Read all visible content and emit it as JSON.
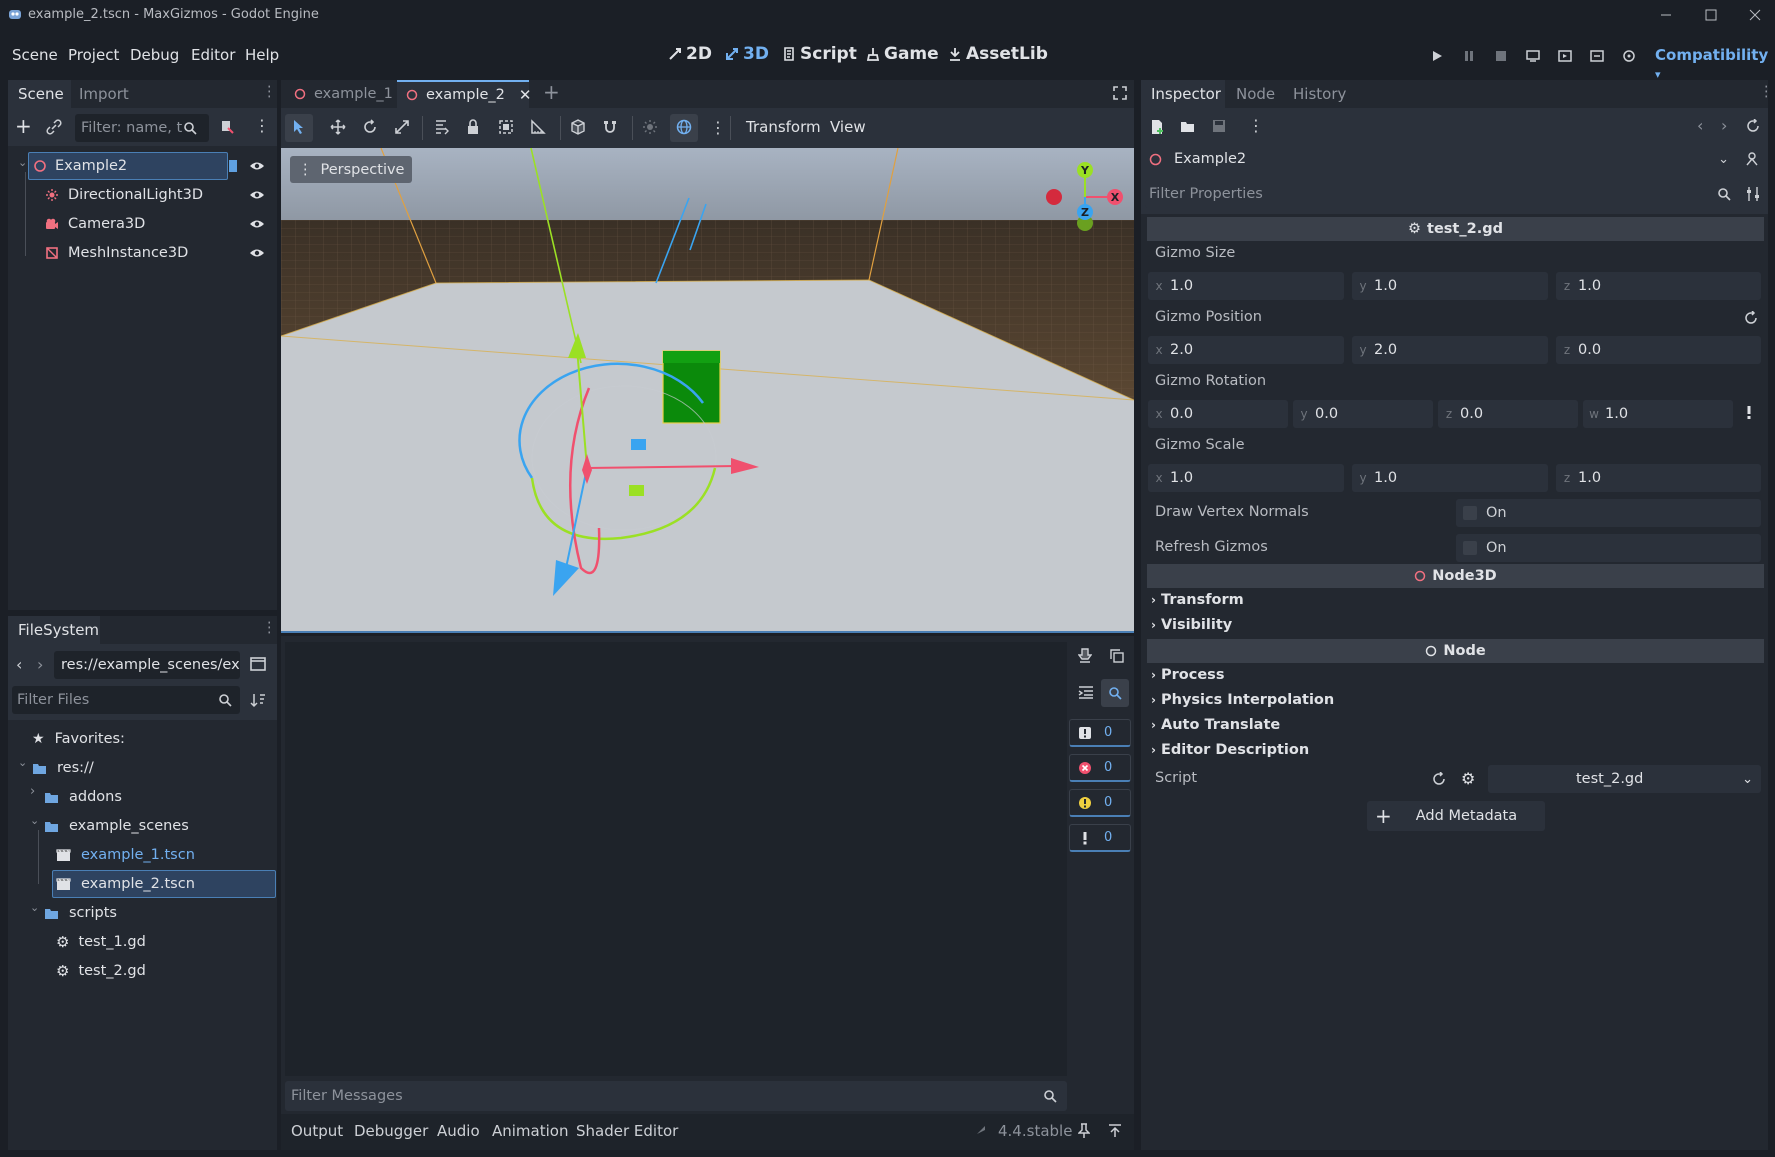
{
  "window": {
    "title": "example_2.tscn - MaxGizmos - Godot Engine"
  },
  "menu": [
    "Scene",
    "Project",
    "Debug",
    "Editor",
    "Help"
  ],
  "main_tabs": [
    {
      "label": "2D",
      "active": false
    },
    {
      "label": "3D",
      "active": true
    },
    {
      "label": "Script",
      "active": false
    },
    {
      "label": "Game",
      "active": false
    },
    {
      "label": "AssetLib",
      "active": false
    }
  ],
  "renderer": "Compatibility",
  "scene_dock": {
    "tabs": [
      "Scene",
      "Import"
    ],
    "filter_placeholder": "Filter: name, t:t",
    "tree": [
      {
        "label": "Example2",
        "icon": "node3d-icon",
        "selected": true
      },
      {
        "label": "DirectionalLight3D",
        "icon": "light-icon"
      },
      {
        "label": "Camera3D",
        "icon": "camera-icon"
      },
      {
        "label": "MeshInstance3D",
        "icon": "mesh-icon"
      }
    ]
  },
  "filesystem": {
    "tab": "FileSystem",
    "path": "res://example_scenes/exa",
    "filter_placeholder": "Filter Files",
    "items": [
      {
        "label": "Favorites:",
        "icon": "star-icon"
      },
      {
        "label": "res://",
        "icon": "folder-icon"
      },
      {
        "label": "addons",
        "icon": "folder-icon"
      },
      {
        "label": "example_scenes",
        "icon": "folder-icon"
      },
      {
        "label": "example_1.tscn",
        "icon": "scene-icon"
      },
      {
        "label": "example_2.tscn",
        "icon": "scene-icon",
        "selected": true
      },
      {
        "label": "scripts",
        "icon": "folder-icon"
      },
      {
        "label": "test_1.gd",
        "icon": "gear-icon"
      },
      {
        "label": "test_2.gd",
        "icon": "gear-icon"
      }
    ]
  },
  "editor_tabs": [
    {
      "label": "example_1",
      "active": false
    },
    {
      "label": "example_2",
      "active": true
    }
  ],
  "viewport_toolbar": {
    "transform": "Transform",
    "view": "View"
  },
  "viewport": {
    "perspective": "Perspective",
    "gizmo_axes": [
      "Y",
      "X",
      "Z"
    ]
  },
  "output": {
    "counters": [
      0,
      0,
      0,
      0
    ],
    "filter_placeholder": "Filter Messages",
    "bottom_tabs": [
      "Output",
      "Debugger",
      "Audio",
      "Animation",
      "Shader Editor"
    ],
    "version": "4.4.stable"
  },
  "inspector": {
    "tabs": [
      "Inspector",
      "Node",
      "History"
    ],
    "object": "Example2",
    "filter_placeholder": "Filter Properties",
    "script_section": "test_2.gd",
    "gizmo_size": {
      "label": "Gizmo Size",
      "x": "1.0",
      "y": "1.0",
      "z": "1.0"
    },
    "gizmo_position": {
      "label": "Gizmo Position",
      "x": "2.0",
      "y": "2.0",
      "z": "0.0"
    },
    "gizmo_rotation": {
      "label": "Gizmo Rotation",
      "x": "0.0",
      "y": "0.0",
      "z": "0.0",
      "w": "1.0"
    },
    "gizmo_scale": {
      "label": "Gizmo Scale",
      "x": "1.0",
      "y": "1.0",
      "z": "1.0"
    },
    "draw_vertex_normals": {
      "label": "Draw Vertex Normals",
      "value": "On"
    },
    "refresh_gizmos": {
      "label": "Refresh Gizmos",
      "value": "On"
    },
    "node3d_section": "Node3D",
    "node3d_groups": [
      "Transform",
      "Visibility"
    ],
    "node_section": "Node",
    "node_groups": [
      "Process",
      "Physics Interpolation",
      "Auto Translate",
      "Editor Description"
    ],
    "script": {
      "label": "Script",
      "value": "test_2.gd"
    },
    "add_metadata": "Add Metadata"
  },
  "colors": {
    "accent": "#72b0f0",
    "x_axis": "#f0506e",
    "y_axis": "#9be024",
    "z_axis": "#3aa4f0",
    "cube": "#0b8a0b"
  }
}
